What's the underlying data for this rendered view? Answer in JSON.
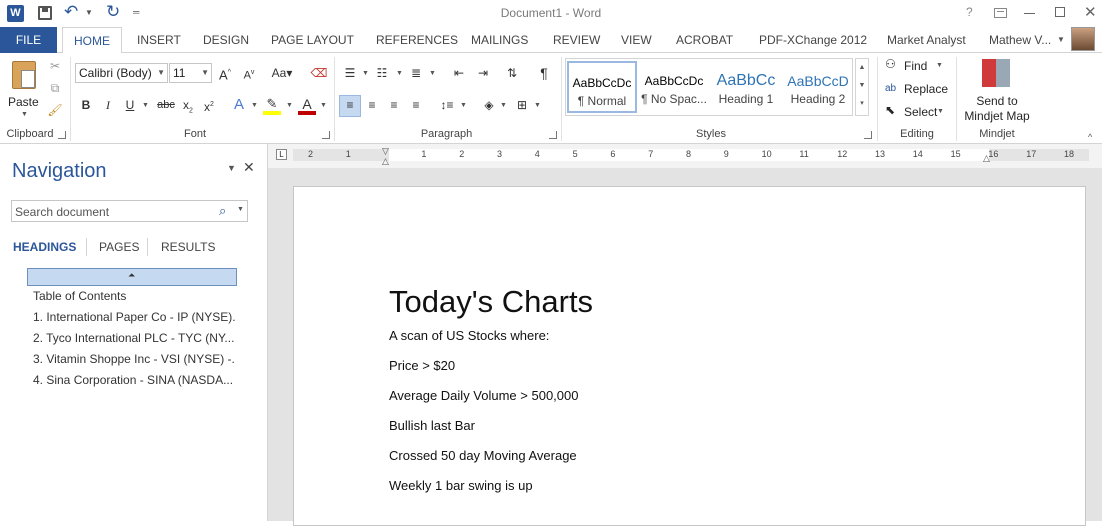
{
  "window": {
    "title": "Document1 - Word",
    "help": "?"
  },
  "qat": {
    "word_icon": "W"
  },
  "tabs": {
    "file": "FILE",
    "home": "HOME",
    "insert": "INSERT",
    "design": "DESIGN",
    "page_layout": "PAGE LAYOUT",
    "references": "REFERENCES",
    "mailings": "MAILINGS",
    "review": "REVIEW",
    "view": "VIEW",
    "acrobat": "ACROBAT",
    "pdfxchange": "PDF-XChange 2012",
    "market_analyst": "Market Analyst",
    "user": "Mathew V..."
  },
  "ribbon": {
    "clipboard": {
      "paste": "Paste",
      "label": "Clipboard"
    },
    "font": {
      "family": "Calibri (Body)",
      "size": "11",
      "label": "Font"
    },
    "paragraph": {
      "label": "Paragraph"
    },
    "styles": {
      "label": "Styles",
      "items": [
        {
          "sample": "AaBbCcDc",
          "name": "¶ Normal"
        },
        {
          "sample": "AaBbCcDc",
          "name": "¶ No Spac..."
        },
        {
          "sample": "AaBbCc",
          "name": "Heading 1"
        },
        {
          "sample": "AaBbCcD",
          "name": "Heading 2"
        }
      ]
    },
    "editing": {
      "find": "Find",
      "replace": "Replace",
      "select": "Select",
      "label": "Editing"
    },
    "mindjet": {
      "send1": "Send to",
      "send2": "Mindjet Map",
      "label": "Mindjet"
    }
  },
  "navigation": {
    "title": "Navigation",
    "search_placeholder": "Search document",
    "tabs": {
      "headings": "HEADINGS",
      "pages": "PAGES",
      "results": "RESULTS"
    },
    "headings": [
      "Table of Contents",
      "1. International Paper Co - IP (NYSE)...",
      "2. Tyco International PLC - TYC (NY...",
      "3. Vitamin Shoppe Inc - VSI (NYSE) -...",
      "4. Sina Corporation - SINA (NASDA..."
    ]
  },
  "ruler": {
    "ticks": [
      "2",
      "1",
      "1",
      "2",
      "3",
      "4",
      "5",
      "6",
      "7",
      "8",
      "9",
      "10",
      "11",
      "12",
      "13",
      "14",
      "15",
      "16",
      "17",
      "18"
    ]
  },
  "document": {
    "title": "Today's Charts",
    "lines": [
      "A scan of US Stocks where:",
      "Price > $20",
      "Average Daily Volume > 500,000",
      "Bullish last Bar",
      "Crossed 50 day Moving Average",
      "Weekly 1 bar swing is up"
    ]
  },
  "colors": {
    "accent": "#2b579a",
    "highlight": "#ffff00",
    "font_color": "#c00000",
    "nav_title": "#2b579a"
  }
}
